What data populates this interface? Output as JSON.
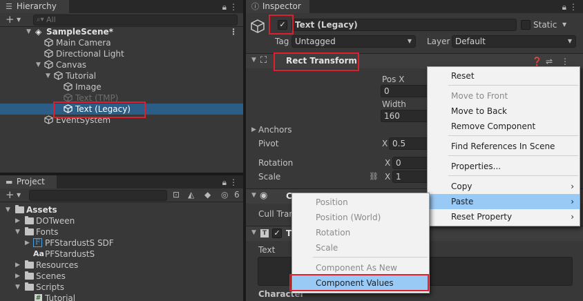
{
  "hierarchy": {
    "tab": "Hierarchy",
    "search_placeholder": "All",
    "rows": [
      {
        "label": "SampleScene*"
      },
      {
        "label": "Main Camera"
      },
      {
        "label": "Directional Light"
      },
      {
        "label": "Canvas"
      },
      {
        "label": "Tutorial"
      },
      {
        "label": "Image"
      },
      {
        "label": "Text (TMP)"
      },
      {
        "label": "Text (Legacy)"
      },
      {
        "label": "EventSystem"
      }
    ]
  },
  "project": {
    "tab": "Project",
    "hidden_count": "6",
    "rows": [
      {
        "label": "Assets"
      },
      {
        "label": "DOTween"
      },
      {
        "label": "Fonts"
      },
      {
        "label": "PFStardustS SDF"
      },
      {
        "label": "PFStardustS"
      },
      {
        "label": "Resources"
      },
      {
        "label": "Scenes"
      },
      {
        "label": "Scripts"
      },
      {
        "label": "Tutorial"
      }
    ]
  },
  "inspector": {
    "tab": "Inspector",
    "object_name": "Text (Legacy)",
    "static_label": "Static",
    "tag_label": "Tag",
    "tag_value": "Untagged",
    "layer_label": "Layer",
    "layer_value": "Default",
    "rect_transform": {
      "title": "Rect Transform",
      "pos_x_label": "Pos X",
      "pos_x_value": "0",
      "width_label": "Width",
      "width_value": "160",
      "anchors_label": "Anchors",
      "pivot_label": "Pivot",
      "pivot_x_label": "X",
      "pivot_x_value": "0.5",
      "rotation_label": "Rotation",
      "rotation_x_label": "X",
      "rotation_x_value": "0",
      "scale_label": "Scale",
      "scale_x_label": "X",
      "scale_x_value": "1"
    },
    "canvas_renderer": {
      "title": "C",
      "cull_label": "Cull Tran"
    },
    "text_component": {
      "title": "T",
      "text_label": "Text",
      "character_label": "Character"
    }
  },
  "context_menu": {
    "items": [
      {
        "label": "Reset",
        "enabled": true
      },
      {
        "label": "Move to Front",
        "enabled": false
      },
      {
        "label": "Move to Back",
        "enabled": true
      },
      {
        "label": "Remove Component",
        "enabled": true
      },
      {
        "label": "Find References In Scene",
        "enabled": true
      },
      {
        "label": "Properties...",
        "enabled": true
      },
      {
        "label": "Copy",
        "enabled": true,
        "submenu": true
      },
      {
        "label": "Paste",
        "enabled": true,
        "submenu": true,
        "highlighted": true
      },
      {
        "label": "Reset Property",
        "enabled": true,
        "submenu": true
      }
    ]
  },
  "paste_submenu": {
    "items": [
      {
        "label": "Position",
        "enabled": false
      },
      {
        "label": "Position (World)",
        "enabled": false
      },
      {
        "label": "Rotation",
        "enabled": false
      },
      {
        "label": "Scale",
        "enabled": false
      },
      {
        "label": "Component As New",
        "enabled": false
      },
      {
        "label": "Component Values",
        "enabled": true,
        "highlighted": true
      }
    ]
  },
  "colors": {
    "highlight_red": "#e01e2d",
    "selection_blue": "#2c5d87",
    "menu_highlight": "#99c9f5"
  }
}
